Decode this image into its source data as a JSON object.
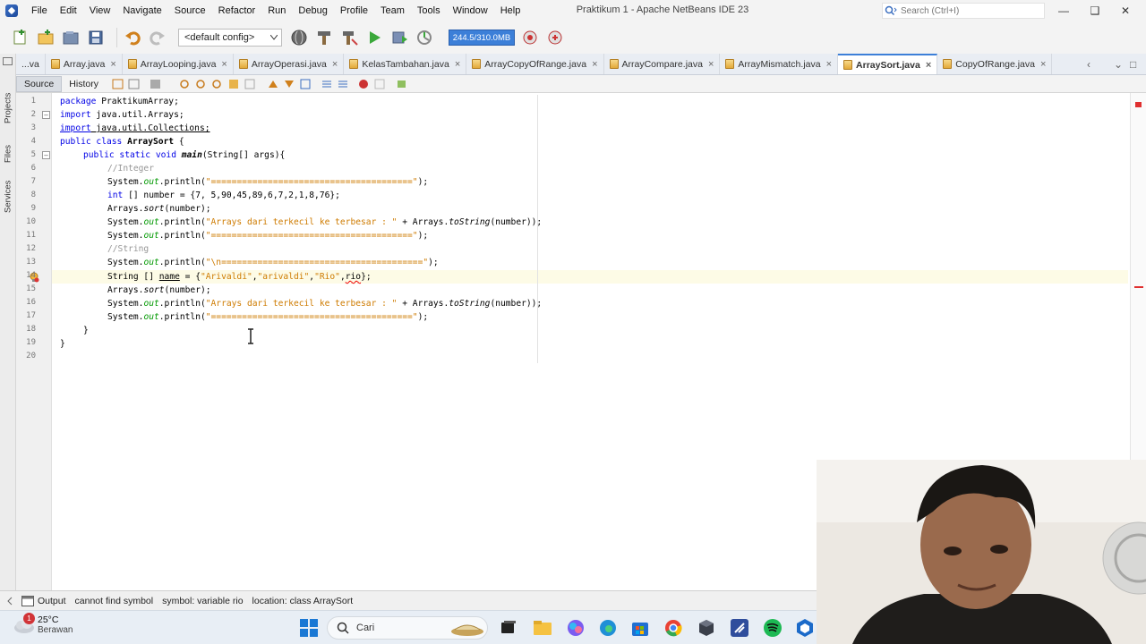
{
  "window": {
    "title": "Praktikum 1 - Apache NetBeans IDE 23",
    "search_placeholder": "Search (Ctrl+I)"
  },
  "menu": [
    "File",
    "Edit",
    "View",
    "Navigate",
    "Source",
    "Refactor",
    "Run",
    "Debug",
    "Profile",
    "Team",
    "Tools",
    "Window",
    "Help"
  ],
  "toolbar": {
    "config_value": "<default config>",
    "memory": "244.5/310.0MB"
  },
  "side_tabs": [
    "Projects",
    "Files",
    "Services"
  ],
  "tabs": [
    {
      "label": "...va",
      "active": false
    },
    {
      "label": "Array.java",
      "active": false
    },
    {
      "label": "ArrayLooping.java",
      "active": false
    },
    {
      "label": "ArrayOperasi.java",
      "active": false
    },
    {
      "label": "KelasTambahan.java",
      "active": false
    },
    {
      "label": "ArrayCopyOfRange.java",
      "active": false
    },
    {
      "label": "ArrayCompare.java",
      "active": false
    },
    {
      "label": "ArrayMismatch.java",
      "active": false
    },
    {
      "label": "ArraySort.java",
      "active": true
    },
    {
      "label": "CopyOfRange.java",
      "active": false
    }
  ],
  "editor_views": {
    "source": "Source",
    "history": "History"
  },
  "code": {
    "line_numbers": [
      "1",
      "2",
      "3",
      "4",
      "5",
      "6",
      "7",
      "8",
      "9",
      "10",
      "11",
      "12",
      "13",
      "14",
      "15",
      "16",
      "17",
      "18",
      "19",
      "20"
    ],
    "l1_kw": "package",
    "l1_rest": " PraktikumArray;",
    "l2_kw": "import",
    "l2_rest": " java.util.Arrays;",
    "l3_kw": "import",
    "l3_rest": " java.util.Collections;",
    "l4_kw": "public class",
    "l4_name": " ArraySort",
    "l4_rest": " {",
    "l5_kw": "public static void",
    "l5_name": " main",
    "l5_rest": "(String[] args){",
    "l6": "//Integer",
    "l7_a": "System.",
    "l7_out": "out",
    "l7_b": ".println(",
    "l7_str": "\"=======================================\"",
    "l7_c": ");",
    "l8_kw": "int",
    "l8_rest": " [] number = {7, 5,90,45,89,6,7,2,1,8,76};",
    "l9_a": "Arrays.",
    "l9_m": "sort",
    "l9_b": "(number);",
    "l10_a": "System.",
    "l10_out": "out",
    "l10_b": ".println(",
    "l10_str": "\"Arrays dari terkecil ke terbesar : \"",
    "l10_c": " + Arrays.",
    "l10_m": "toString",
    "l10_d": "(number));",
    "l11_a": "System.",
    "l11_out": "out",
    "l11_b": ".println(",
    "l11_str": "\"=======================================\"",
    "l11_c": ");",
    "l12": "//String",
    "l13_a": "System.",
    "l13_out": "out",
    "l13_b": ".println(",
    "l13_str": "\"\\n=======================================\"",
    "l13_c": ");",
    "l14_a": "String [] ",
    "l14_name": "name",
    "l14_b": " = {",
    "l14_s1": "\"Arivaldi\"",
    "l14_c1": ",",
    "l14_s2": "\"arivaldi\"",
    "l14_c2": ",",
    "l14_s3": "\"Rio\"",
    "l14_c3": ",",
    "l14_err": "rio",
    "l14_end": "};",
    "l15_a": "Arrays.",
    "l15_m": "sort",
    "l15_b": "(number);",
    "l16_a": "System.",
    "l16_out": "out",
    "l16_b": ".println(",
    "l16_str": "\"Arrays dari terkecil ke terbesar : \"",
    "l16_c": " + Arrays.",
    "l16_m": "toString",
    "l16_d": "(number));",
    "l17_a": "System.",
    "l17_out": "out",
    "l17_b": ".println(",
    "l17_str": "\"=======================================\"",
    "l17_c": ");",
    "l18": "}",
    "l19": "}"
  },
  "output": {
    "tab_label": "Output",
    "message": "cannot find symbol",
    "symbol": "symbol:   variable rio",
    "location": "location: class ArraySort"
  },
  "taskbar": {
    "temperature": "25°C",
    "condition": "Berawan",
    "notification_count": "1",
    "search_label": "Cari"
  }
}
